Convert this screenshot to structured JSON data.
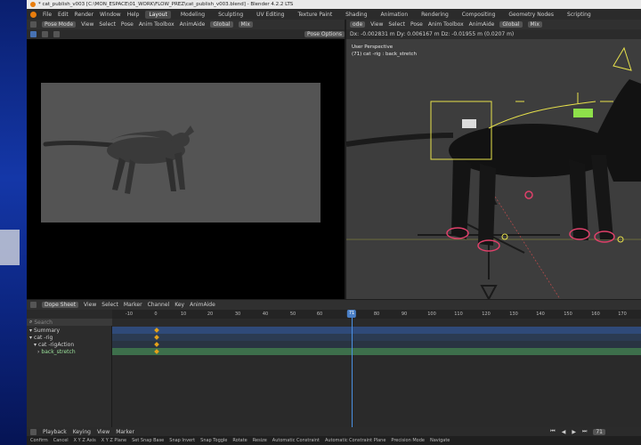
{
  "window": {
    "title": "* cat_publish_v003 [C:\\MON_ESPACE\\01_WORK\\FLOW_PREZ\\cat_publish_v003.blend] - Blender 4.2.2 LTS"
  },
  "menu": [
    "File",
    "Edit",
    "Render",
    "Window",
    "Help"
  ],
  "workspaces": [
    "Layout",
    "Modeling",
    "Sculpting",
    "UV Editing",
    "Texture Paint",
    "Shading",
    "Animation",
    "Rendering",
    "Compositing",
    "Geometry Nodes",
    "Scripting"
  ],
  "left_header": {
    "mode": "Pose Mode",
    "items": [
      "View",
      "Select",
      "Pose",
      "Anim Toolbox",
      "AnimAide"
    ],
    "orientation": "Global",
    "mix": "Mix",
    "pose_options": "Pose Options"
  },
  "right_header": {
    "mode": "ode",
    "items": [
      "View",
      "Select",
      "Pose",
      "Anim Toolbox",
      "AnimAide"
    ],
    "orientation": "Global",
    "mix": "Mix"
  },
  "viewport": {
    "delta_readout": "Dx: -0.002831 m  Dy: 0.006167 m  Dz: -0.01955 m (0.0207 m)",
    "perspective": "User Perspective",
    "object": "(71) cat -rig : back_stretch"
  },
  "dopesheet": {
    "mode": "Dope Sheet",
    "menus": [
      "View",
      "Select",
      "Marker",
      "Channel",
      "Key",
      "AnimAide"
    ],
    "search_placeholder": "Search",
    "ruler_ticks": [
      "-10",
      "0",
      "10",
      "20",
      "30",
      "40",
      "50",
      "60",
      "70",
      "80",
      "90",
      "100",
      "110",
      "120",
      "130",
      "140",
      "150",
      "160",
      "170"
    ],
    "current_frame": "71",
    "channels": [
      {
        "label": "Summary",
        "color": "#2f4a79"
      },
      {
        "label": "cat -rig",
        "color": "#2b3b52"
      },
      {
        "label": "cat -rigAction",
        "color": "#293442"
      },
      {
        "label": "back_stretch",
        "color": "#3d6f4b"
      }
    ]
  },
  "playback": {
    "items": [
      "Playback",
      "Keying",
      "View",
      "Marker"
    ],
    "frame": "71"
  },
  "status": [
    "Confirm",
    "Cancel",
    "X Y Z Axis",
    "X Y Z Plane",
    "Set Snap Base",
    "Snap Invert",
    "Snap Toggle",
    "Rotate",
    "Resize",
    "Automatic Constraint",
    "Automatic Constraint Plane",
    "Precision Mode",
    "Navigate"
  ],
  "colors": {
    "accent": "#4772b3",
    "keyframe": "#e3a21a",
    "bone_selected": "#8ee04a"
  }
}
